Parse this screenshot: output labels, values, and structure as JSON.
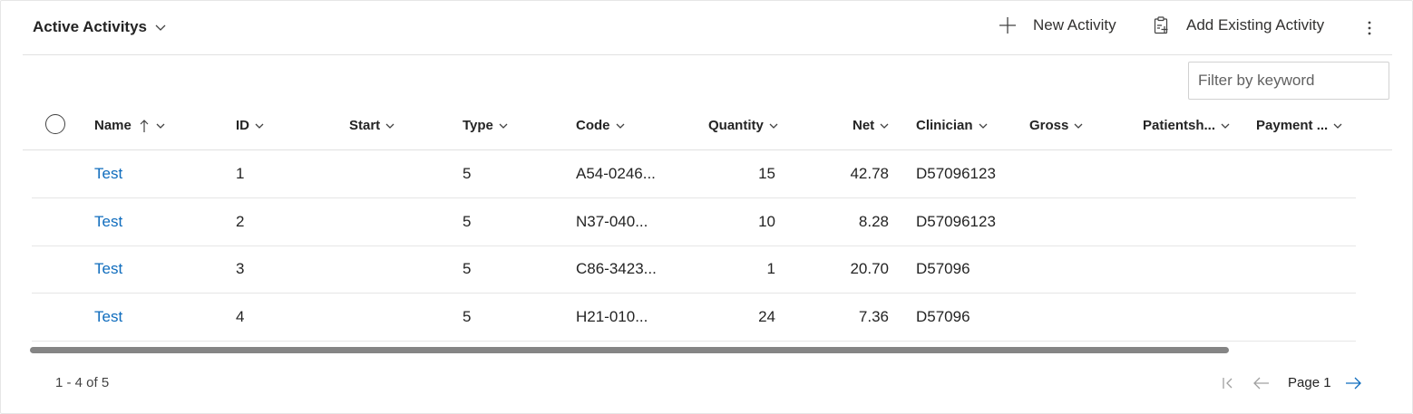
{
  "header": {
    "title": "Active Activitys",
    "new_activity_label": "New Activity",
    "add_existing_label": "Add Existing Activity"
  },
  "filter": {
    "placeholder": "Filter by keyword",
    "value": ""
  },
  "columns": [
    "Name",
    "ID",
    "Start",
    "Type",
    "Code",
    "Quantity",
    "Net",
    "Clinician",
    "Gross",
    "Patientsh...",
    "Payment ..."
  ],
  "sort": {
    "column": "Name",
    "direction": "ascending"
  },
  "rows": [
    {
      "name": "Test",
      "id": "1",
      "start": "",
      "type": "5",
      "code": "A54-0246...",
      "quantity": "15",
      "net": "42.78",
      "clinician": "D57096123",
      "gross": "",
      "patientshare": "",
      "payment": ""
    },
    {
      "name": "Test",
      "id": "2",
      "start": "",
      "type": "5",
      "code": "N37-040...",
      "quantity": "10",
      "net": "8.28",
      "clinician": "D57096123",
      "gross": "",
      "patientshare": "",
      "payment": ""
    },
    {
      "name": "Test",
      "id": "3",
      "start": "",
      "type": "5",
      "code": "C86-3423...",
      "quantity": "1",
      "net": "20.70",
      "clinician": "D57096",
      "gross": "",
      "patientshare": "",
      "payment": ""
    },
    {
      "name": "Test",
      "id": "4",
      "start": "",
      "type": "5",
      "code": "H21-010...",
      "quantity": "24",
      "net": "7.36",
      "clinician": "D57096",
      "gross": "",
      "patientshare": "",
      "payment": ""
    }
  ],
  "footer": {
    "record_count": "1 - 4 of 5",
    "page_label": "Page 1"
  },
  "colors": {
    "link": "#0f6cbd",
    "text": "#242424",
    "border": "#e1e1e1"
  },
  "icons": [
    "chevron-down-icon",
    "add-icon",
    "clipboard-add-icon",
    "more-vertical-icon",
    "sort-up-arrow-icon",
    "first-page-icon",
    "previous-page-icon",
    "next-page-icon"
  ]
}
